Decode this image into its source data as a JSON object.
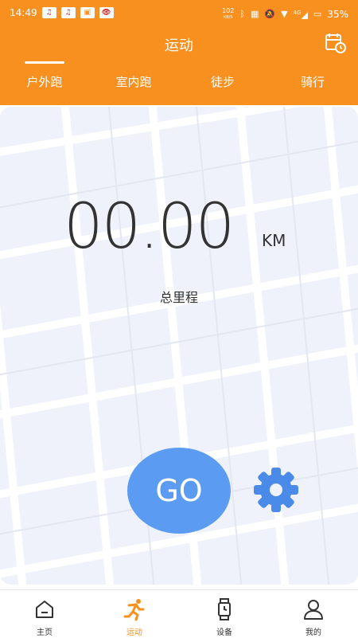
{
  "status_bar": {
    "time": "14:49",
    "speed_top": "102",
    "speed_bottom": "KB/S",
    "network": "4G",
    "battery": "35%"
  },
  "header": {
    "title": "运动"
  },
  "tabs": [
    {
      "label": "户外跑",
      "active": true
    },
    {
      "label": "室内跑",
      "active": false
    },
    {
      "label": "徒步",
      "active": false
    },
    {
      "label": "骑行",
      "active": false
    }
  ],
  "main": {
    "distance": "00.00",
    "unit": "KM",
    "distance_label": "总里程",
    "go_label": "GO"
  },
  "bottom_nav": [
    {
      "label": "主页",
      "icon": "home-icon",
      "active": false
    },
    {
      "label": "运动",
      "icon": "running-icon",
      "active": true
    },
    {
      "label": "设备",
      "icon": "watch-icon",
      "active": false
    },
    {
      "label": "我的",
      "icon": "person-icon",
      "active": false
    }
  ],
  "colors": {
    "brand_orange": "#F7901E",
    "go_blue": "#5B9CF2",
    "map_bg": "#EFF2FA"
  }
}
